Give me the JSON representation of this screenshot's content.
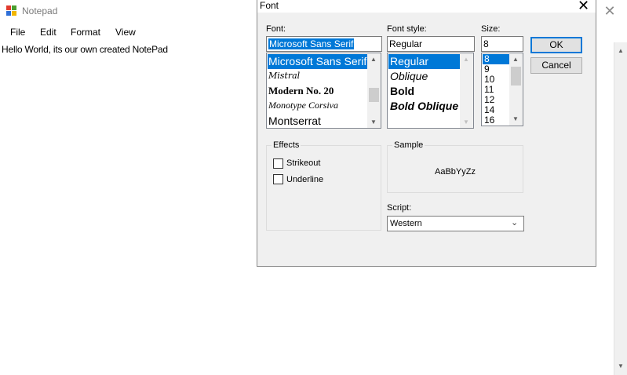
{
  "notepad": {
    "title": "Notepad",
    "menu": [
      "File",
      "Edit",
      "Format",
      "View"
    ],
    "content": "Hello World, its our own created NotePad",
    "close_glyph": "✕"
  },
  "dialog": {
    "title": "Font",
    "close_glyph": "✕",
    "font_label": "Font:",
    "font_value": "Microsoft Sans Serif",
    "font_list": [
      "Microsoft Sans Serif",
      "Mistral",
      "Modern No. 20",
      "Monotype Corsiva",
      "Montserrat"
    ],
    "style_label": "Font style:",
    "style_value": "Regular",
    "style_list": [
      "Regular",
      "Oblique",
      "Bold",
      "Bold Oblique"
    ],
    "size_label": "Size:",
    "size_value": "8",
    "size_list": [
      "8",
      "9",
      "10",
      "11",
      "12",
      "14",
      "16"
    ],
    "ok_label": "OK",
    "cancel_label": "Cancel",
    "effects_label": "Effects",
    "strikeout_label": "Strikeout",
    "underline_label": "Underline",
    "sample_label": "Sample",
    "sample_text": "AaBbYyZz",
    "script_label": "Script:",
    "script_value": "Western"
  },
  "colors": {
    "selection": "#0078d7",
    "dialog_bg": "#f0f0f0"
  },
  "icons": {
    "notepad_app": "notepad-icon",
    "close": "close-icon",
    "scroll_up": "chevron-up-icon",
    "scroll_down": "chevron-down-icon"
  }
}
